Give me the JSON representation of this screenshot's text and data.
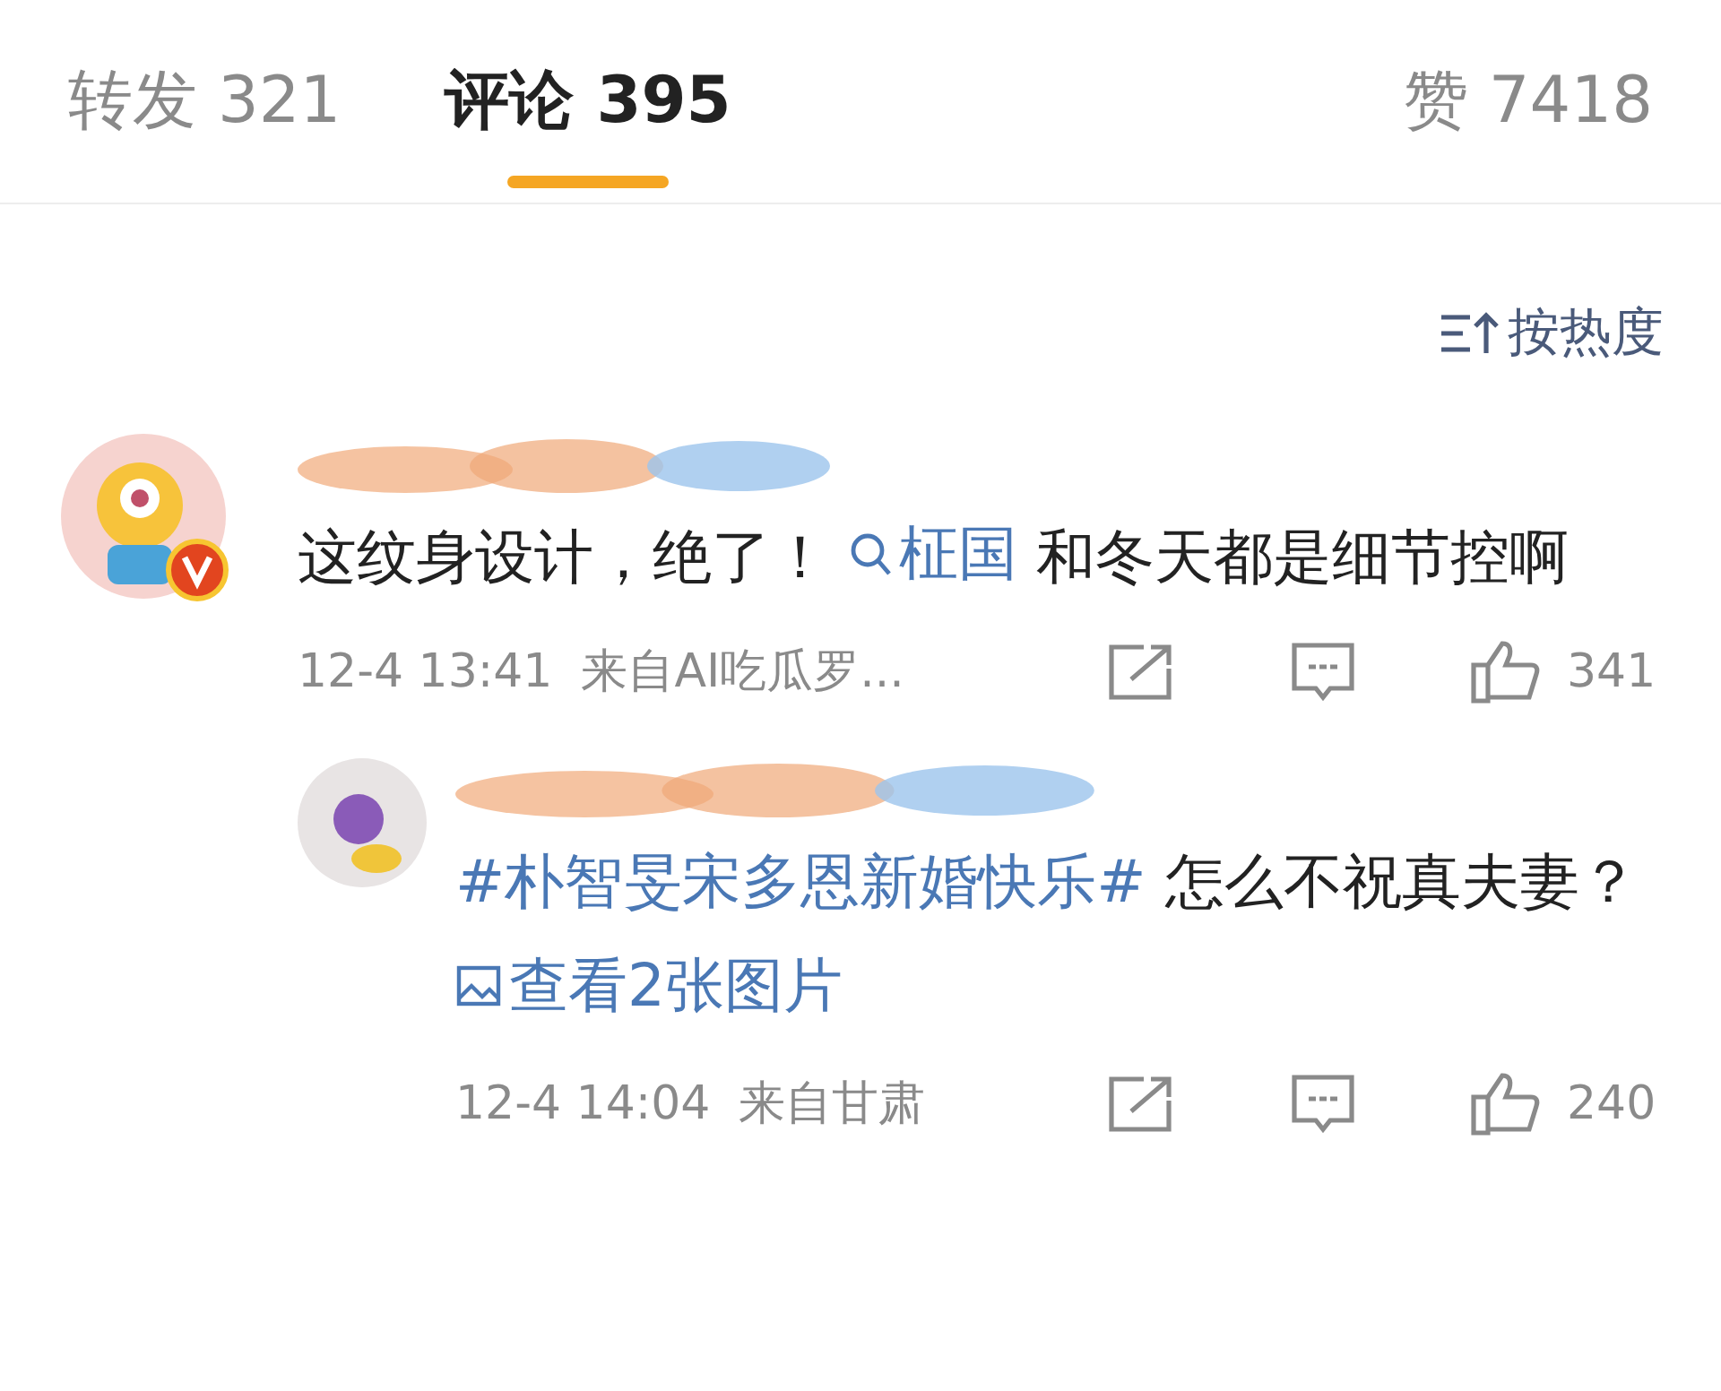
{
  "tabs": [
    {
      "label": "转发 321",
      "selected": false
    },
    {
      "label": "评论 395",
      "selected": true
    },
    {
      "label": "赞 7418",
      "selected": false
    }
  ],
  "sort": {
    "label": "按热度"
  },
  "comments": [
    {
      "segments": [
        {
          "kind": "text",
          "text": "这纹身设计，绝了！ "
        },
        {
          "kind": "search",
          "text": "柾国"
        },
        {
          "kind": "text",
          "text": " 和冬天都是细节控啊"
        }
      ],
      "time": "12-4 13:41",
      "source": "来自AI吃瓜罗...",
      "likes": "341",
      "replies": [
        {
          "segments": [
            {
              "kind": "topic",
              "text": "#朴智旻宋多恩新婚快乐#"
            },
            {
              "kind": "text",
              "text": " 怎么不祝真夫妻？ "
            },
            {
              "kind": "images",
              "text": "查看2张图片"
            }
          ],
          "time": "12-4 14:04",
          "source": "来自甘肃",
          "likes": "240"
        }
      ]
    }
  ]
}
